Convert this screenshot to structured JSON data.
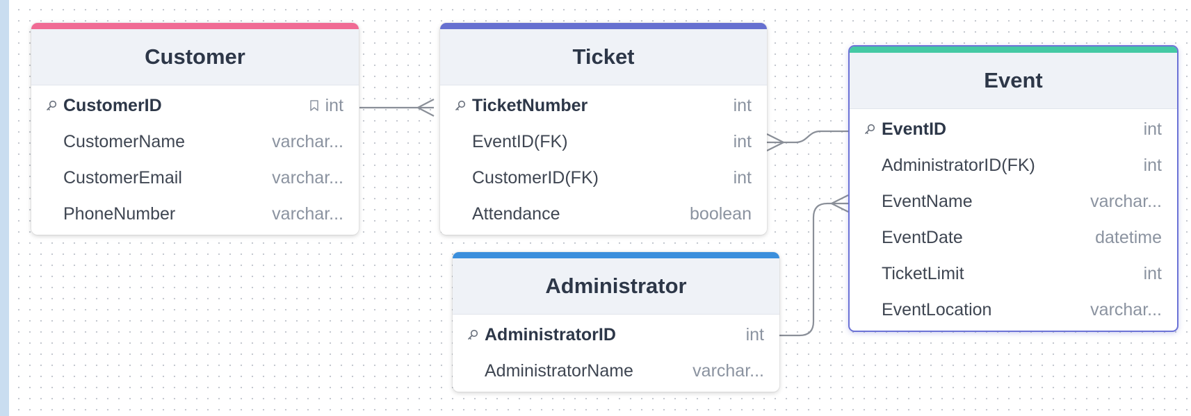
{
  "tables": [
    {
      "id": "customer",
      "title": "Customer",
      "accent": "#f06b94",
      "columns": [
        {
          "name": "CustomerID",
          "type": "int",
          "pk": true,
          "not_null_icon": true
        },
        {
          "name": "CustomerName",
          "type": "varchar..."
        },
        {
          "name": "CustomerEmail",
          "type": "varchar..."
        },
        {
          "name": "PhoneNumber",
          "type": "varchar..."
        }
      ]
    },
    {
      "id": "ticket",
      "title": "Ticket",
      "accent": "#6670d0",
      "columns": [
        {
          "name": "TicketNumber",
          "type": "int",
          "pk": true
        },
        {
          "name": "EventID(FK)",
          "type": "int"
        },
        {
          "name": "CustomerID(FK)",
          "type": "int"
        },
        {
          "name": "Attendance",
          "type": "boolean"
        }
      ]
    },
    {
      "id": "administrator",
      "title": "Administrator",
      "accent": "#3b8fdc",
      "columns": [
        {
          "name": "AdministratorID",
          "type": "int",
          "pk": true
        },
        {
          "name": "AdministratorName",
          "type": "varchar..."
        }
      ]
    },
    {
      "id": "event",
      "title": "Event",
      "accent": "#44c9a4",
      "columns": [
        {
          "name": "EventID",
          "type": "int",
          "pk": true
        },
        {
          "name": "AdministratorID(FK)",
          "type": "int"
        },
        {
          "name": "EventName",
          "type": "varchar..."
        },
        {
          "name": "EventDate",
          "type": "datetime"
        },
        {
          "name": "TicketLimit",
          "type": "int"
        },
        {
          "name": "EventLocation",
          "type": "varchar..."
        }
      ]
    }
  ],
  "relationships": [
    {
      "from": "Customer.CustomerID",
      "to": "Ticket.TicketNumber",
      "cardinality": "one-to-many"
    },
    {
      "from": "Event.EventID",
      "to": "Ticket.EventID(FK)",
      "cardinality": "one-to-many"
    },
    {
      "from": "Administrator.AdministratorID",
      "to": "Event.EventName",
      "cardinality": "one-to-many"
    }
  ],
  "colors": {
    "connector": "#8a8f98",
    "selected_border": "#6b72d6",
    "header_bg": "#eff2f7"
  }
}
